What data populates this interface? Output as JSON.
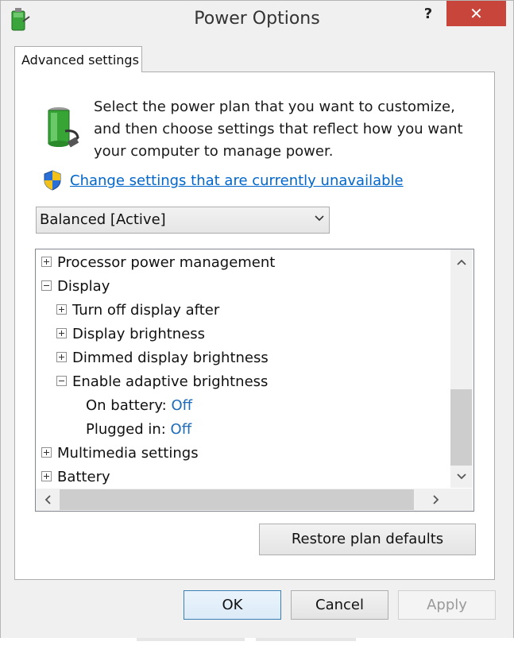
{
  "window": {
    "title": "Power Options",
    "help_label": "?",
    "close_label": "✕"
  },
  "tab": {
    "label": "Advanced settings"
  },
  "intro": {
    "text": "Select the power plan that you want to customize, and then choose settings that reflect how you want your computer to manage power.",
    "uac_link": "Change settings that are currently unavailable"
  },
  "plan_select": {
    "value": "Balanced [Active]"
  },
  "tree": {
    "processor": "Processor power management",
    "display": "Display",
    "turn_off": "Turn off display after",
    "brightness": "Display brightness",
    "dimmed": "Dimmed display brightness",
    "adaptive": "Enable adaptive brightness",
    "on_battery_label": "On battery:",
    "on_battery_value": "Off",
    "plugged_in_label": "Plugged in:",
    "plugged_in_value": "Off",
    "multimedia": "Multimedia settings",
    "battery": "Battery"
  },
  "buttons": {
    "restore": "Restore plan defaults",
    "ok": "OK",
    "cancel": "Cancel",
    "apply": "Apply"
  },
  "colors": {
    "close_red": "#c7453a",
    "link_blue": "#0066cc",
    "value_blue": "#1e6bb8"
  },
  "icons": [
    "battery-plug-icon",
    "uac-shield-icon",
    "chevron-down-icon",
    "scroll-up-icon",
    "scroll-down-icon",
    "scroll-left-icon",
    "scroll-right-icon"
  ]
}
